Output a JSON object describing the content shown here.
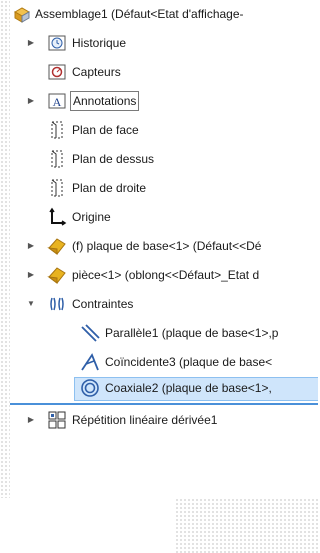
{
  "tree": {
    "root_label": "Assemblage1  (Défaut<Etat d'affichage-",
    "items": [
      {
        "label": "Historique"
      },
      {
        "label": "Capteurs"
      },
      {
        "label": "Annotations"
      },
      {
        "label": "Plan de face"
      },
      {
        "label": "Plan de dessus"
      },
      {
        "label": "Plan de droite"
      },
      {
        "label": "Origine"
      },
      {
        "label": "(f) plaque de base<1> (Défaut<<Dé"
      },
      {
        "label": "pièce<1> (oblong<<Défaut>_Etat d"
      },
      {
        "label": "Contraintes"
      },
      {
        "label": "Parallèle1 (plaque de base<1>,p"
      },
      {
        "label": "Coïncidente3 (plaque de base<"
      },
      {
        "label": "Coaxiale2 (plaque de base<1>,"
      },
      {
        "label": "Répétition linéaire dérivée1"
      }
    ]
  },
  "colors": {
    "selection": "#cfe5fb",
    "separator": "#4a90d9",
    "part_yellow": "#e8b320"
  }
}
